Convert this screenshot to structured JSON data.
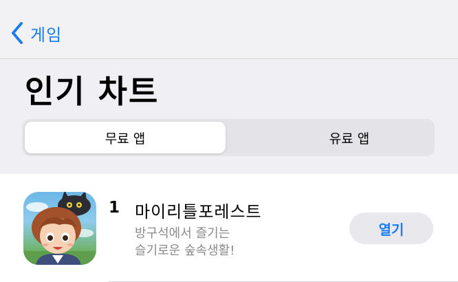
{
  "nav": {
    "back_label": "게임",
    "back_icon": "chevron-left-icon",
    "accent_color": "#1a7cf5"
  },
  "header": {
    "title": "인기 차트"
  },
  "segments": {
    "selected": "무료 앱",
    "items": [
      {
        "label": "무료 앱",
        "active": true
      },
      {
        "label": "유료 앱",
        "active": false
      }
    ]
  },
  "apps": [
    {
      "rank": "1",
      "name": "마이리틀포레스트",
      "subtitle_line1": "방구석에서 즐기는",
      "subtitle_line2": "슬기로운 숲속생활!",
      "action_label": "열기"
    }
  ]
}
